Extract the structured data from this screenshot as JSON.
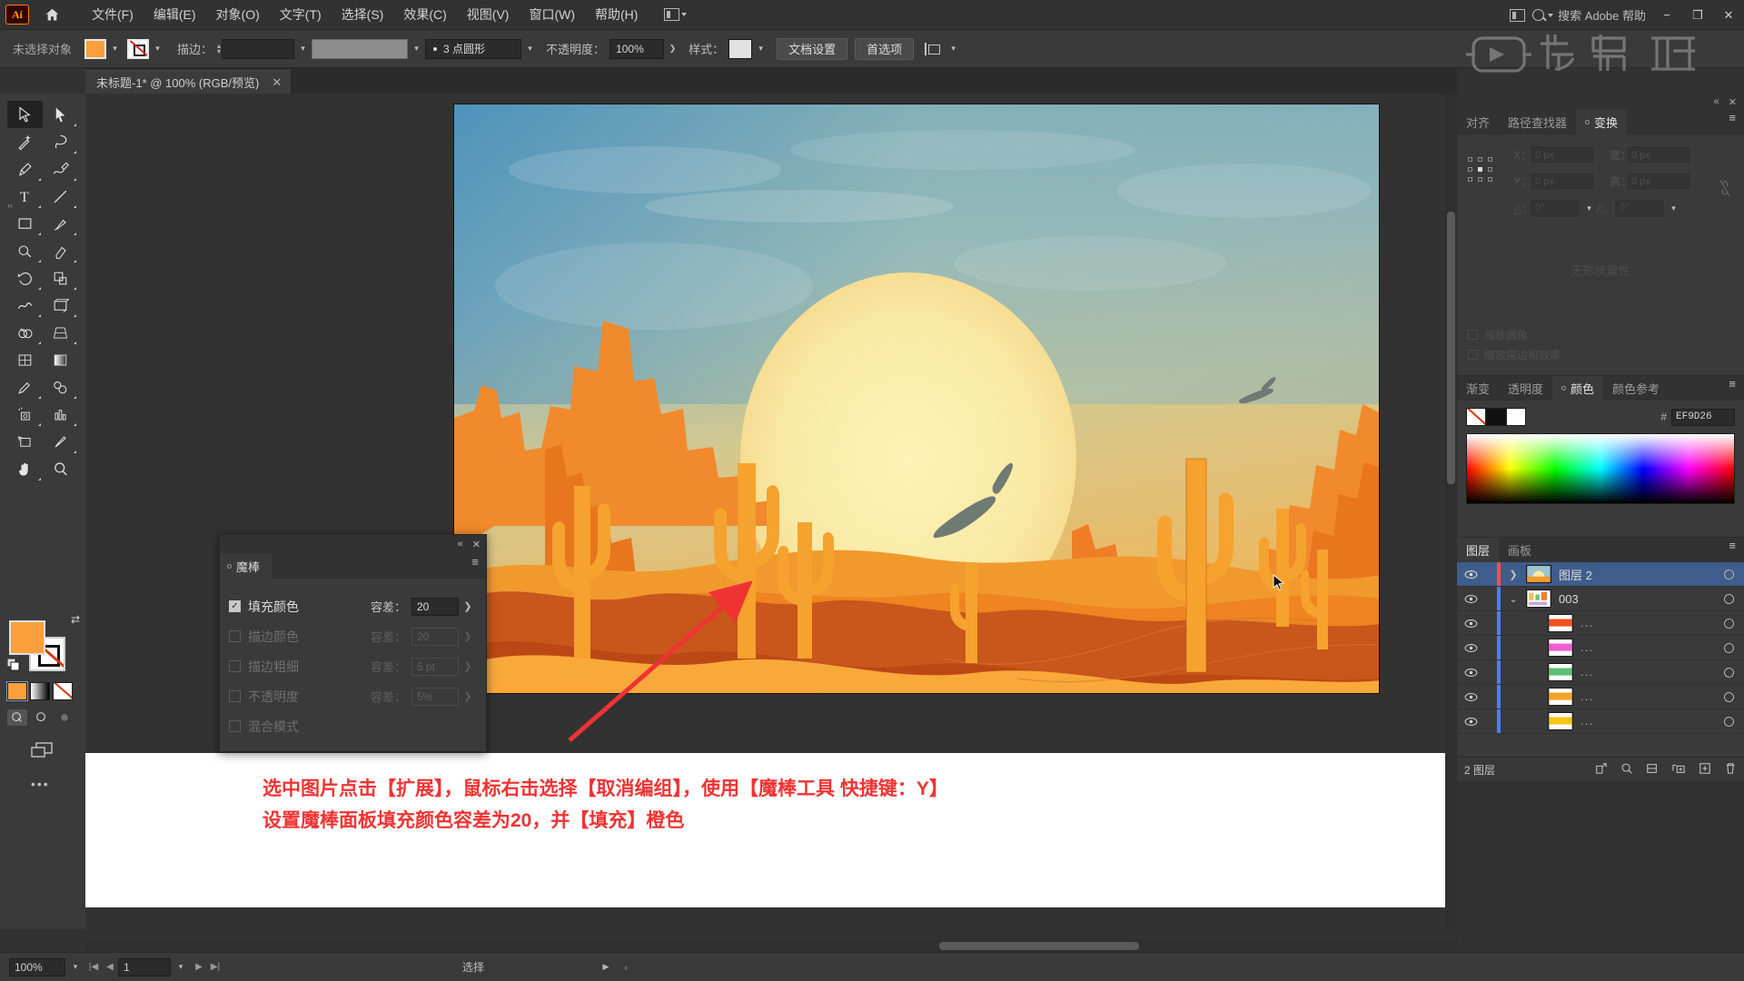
{
  "app": {
    "logo": "Ai",
    "home_icon": "home-icon"
  },
  "menubar": {
    "items": [
      {
        "label": "文件(F)"
      },
      {
        "label": "编辑(E)"
      },
      {
        "label": "对象(O)"
      },
      {
        "label": "文字(T)"
      },
      {
        "label": "选择(S)"
      },
      {
        "label": "效果(C)"
      },
      {
        "label": "视图(V)"
      },
      {
        "label": "窗口(W)"
      },
      {
        "label": "帮助(H)"
      }
    ],
    "workspace_switcher": "workspace-icon",
    "search_placeholder": "搜索 Adobe 帮助",
    "window_minimize": "−",
    "window_restore": "❐",
    "window_close": "✕"
  },
  "options_bar": {
    "selection_status": "未选择对象",
    "fill_color": "#F9A03C",
    "stroke_color": "none",
    "stroke_label": "描边：",
    "stroke_weight": "",
    "stroke_profile": "",
    "brush_label": "3 点圆形",
    "opacity_label": "不透明度：",
    "opacity_value": "100%",
    "style_label": "样式：",
    "doc_setup_button": "文档设置",
    "preferences_button": "首选项",
    "align_icon": "align-icon"
  },
  "document_tab": {
    "title": "未标题-1* @ 100% (RGB/预览)",
    "close": "✕"
  },
  "toolbar": {
    "tools": [
      {
        "name": "selection-tool",
        "active": true
      },
      {
        "name": "direct-selection-tool",
        "active": false
      },
      {
        "name": "magic-wand-tool",
        "active": false
      },
      {
        "name": "lasso-tool",
        "active": false
      },
      {
        "name": "pen-tool",
        "active": false
      },
      {
        "name": "curvature-tool",
        "active": false
      },
      {
        "name": "type-tool",
        "active": false
      },
      {
        "name": "line-segment-tool",
        "active": false
      },
      {
        "name": "rectangle-tool",
        "active": false
      },
      {
        "name": "paintbrush-tool",
        "active": false
      },
      {
        "name": "shaper-tool",
        "active": false
      },
      {
        "name": "eraser-tool",
        "active": false
      },
      {
        "name": "rotate-tool",
        "active": false
      },
      {
        "name": "scale-tool",
        "active": false
      },
      {
        "name": "width-tool",
        "active": false
      },
      {
        "name": "free-transform-tool",
        "active": false
      },
      {
        "name": "shape-builder-tool",
        "active": false
      },
      {
        "name": "perspective-grid-tool",
        "active": false
      },
      {
        "name": "mesh-tool",
        "active": false
      },
      {
        "name": "gradient-tool",
        "active": false
      },
      {
        "name": "eyedropper-tool",
        "active": false
      },
      {
        "name": "blend-tool",
        "active": false
      },
      {
        "name": "symbol-sprayer-tool",
        "active": false
      },
      {
        "name": "column-graph-tool",
        "active": false
      },
      {
        "name": "artboard-tool",
        "active": false
      },
      {
        "name": "slice-tool",
        "active": false
      },
      {
        "name": "hand-tool",
        "active": false
      },
      {
        "name": "zoom-tool",
        "active": false
      }
    ],
    "fill_color": "#F9A03C",
    "stroke_color": "none",
    "more_tools": "•••"
  },
  "magic_wand_panel": {
    "tab_label": "魔棒",
    "collapse": "«",
    "close": "✕",
    "rows": [
      {
        "label": "填充颜色",
        "checked": true,
        "enabled": true,
        "tolerance_label": "容差：",
        "tolerance_value": "20"
      },
      {
        "label": "描边颜色",
        "checked": false,
        "enabled": false,
        "tolerance_label": "容差：",
        "tolerance_value": "20"
      },
      {
        "label": "描边粗细",
        "checked": false,
        "enabled": false,
        "tolerance_label": "容差：",
        "tolerance_value": "5 pt"
      },
      {
        "label": "不透明度",
        "checked": false,
        "enabled": false,
        "tolerance_label": "容差：",
        "tolerance_value": "5%"
      },
      {
        "label": "混合模式",
        "checked": false,
        "enabled": false,
        "tolerance_label": "",
        "tolerance_value": ""
      }
    ]
  },
  "transform_panel": {
    "tabs": [
      {
        "label": "对齐",
        "active": false
      },
      {
        "label": "路径查找器",
        "active": false
      },
      {
        "label": "变换",
        "active": true
      }
    ],
    "x_label": "X：",
    "x_value": "0 px",
    "y_label": "Y：",
    "y_value": "0 px",
    "w_label": "宽：",
    "w_value": "0 px",
    "h_label": "高：",
    "h_value": "0 px",
    "angle_label": "△：",
    "angle_value": "0°",
    "shear_label": "∕：",
    "shear_value": "0°",
    "empty_message": "无形状属性",
    "scale_corners": "缩放圆角",
    "scale_strokes": "缩放描边和效果"
  },
  "color_panel": {
    "tabs": [
      {
        "label": "渐变",
        "active": false
      },
      {
        "label": "透明度",
        "active": false
      },
      {
        "label": "颜色",
        "active": true
      },
      {
        "label": "颜色参考",
        "active": false
      }
    ],
    "hash": "#",
    "hex_value": "EF9D26"
  },
  "layers_panel": {
    "tabs": [
      {
        "label": "图层",
        "active": true
      },
      {
        "label": "画板",
        "active": false
      }
    ],
    "rows": [
      {
        "name": "图层 2",
        "selected": true,
        "indent": 0,
        "expandable": true,
        "expanded": false,
        "color": "#ff4d4d",
        "thumb": "desert"
      },
      {
        "name": "003",
        "selected": false,
        "indent": 1,
        "expandable": true,
        "expanded": true,
        "color": "#4d7fff",
        "thumb": "group"
      },
      {
        "name": "...",
        "selected": false,
        "indent": 2,
        "expandable": false,
        "expanded": false,
        "color": "#4d7fff",
        "thumb": "red"
      },
      {
        "name": "...",
        "selected": false,
        "indent": 2,
        "expandable": false,
        "expanded": false,
        "color": "#4d7fff",
        "thumb": "magenta"
      },
      {
        "name": "...",
        "selected": false,
        "indent": 2,
        "expandable": false,
        "expanded": false,
        "color": "#4d7fff",
        "thumb": "green"
      },
      {
        "name": "...",
        "selected": false,
        "indent": 2,
        "expandable": false,
        "expanded": false,
        "color": "#4d7fff",
        "thumb": "orange"
      },
      {
        "name": "...",
        "selected": false,
        "indent": 2,
        "expandable": false,
        "expanded": false,
        "color": "#4d7fff",
        "thumb": "yellow"
      }
    ],
    "footer_count": "2 图层"
  },
  "statusbar": {
    "zoom": "100%",
    "artboard_number": "1",
    "tool_status": "选择"
  },
  "annotation": {
    "line1": "选中图片点击【扩展】，鼠标右击选择【取消编组】，使用【魔棒工具 快捷键：Y】",
    "line2": "设置魔棒面板填充颜色容差为20，并【填充】橙色",
    "color": "#ef3333"
  },
  "watermark": {
    "text": "虎课网"
  },
  "artwork": {
    "title": "desert-sunset-illustration",
    "sky_top": "#5b9cc0",
    "sky_mid": "#b9cdbf",
    "sun_color": "#f9efb0",
    "sand_color": "#f9a83a",
    "mesa_color": "#ef7d26",
    "dune_dark": "#c94e17"
  }
}
